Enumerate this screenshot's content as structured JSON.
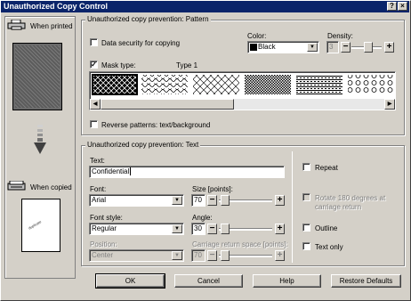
{
  "window": {
    "title": "Unauthorized Copy Control",
    "help": "?",
    "close": "×"
  },
  "left": {
    "when_printed": "When printed",
    "when_copied": "When copied",
    "copied_sample_text": "duplicate"
  },
  "pattern_group": {
    "title": "Unauthorized copy prevention: Pattern",
    "data_security_label": "Data security for copying",
    "data_security_checked": false,
    "color_label": "Color:",
    "color_value": "Black",
    "density_label": "Density:",
    "density_value": "3",
    "mask_type_label": "Mask type:",
    "mask_type_checked": true,
    "mask_type_value": "Type 1",
    "reverse_label": "Reverse patterns: text/background",
    "reverse_checked": false,
    "patterns": [
      "pattern-1",
      "pattern-2",
      "pattern-3",
      "pattern-4",
      "pattern-5",
      "pattern-6"
    ],
    "selected_pattern_index": 0
  },
  "text_group": {
    "title": "Unauthorized copy prevention: Text",
    "text_label": "Text:",
    "text_value": "Confidential",
    "font_label": "Font:",
    "font_value": "Arial",
    "size_label": "Size [points]:",
    "size_value": "70",
    "font_style_label": "Font style:",
    "font_style_value": "Regular",
    "angle_label": "Angle:",
    "angle_value": "30",
    "position_label": "Position:",
    "position_value": "Center",
    "cr_space_label": "Carriage return space [points]:",
    "cr_space_value": "70",
    "repeat_label": "Repeat",
    "rotate_label": "Rotate 180 degrees at carriage return",
    "outline_label": "Outline",
    "text_only_label": "Text only"
  },
  "buttons": {
    "ok": "OK",
    "cancel": "Cancel",
    "help": "Help",
    "restore": "Restore Defaults"
  }
}
